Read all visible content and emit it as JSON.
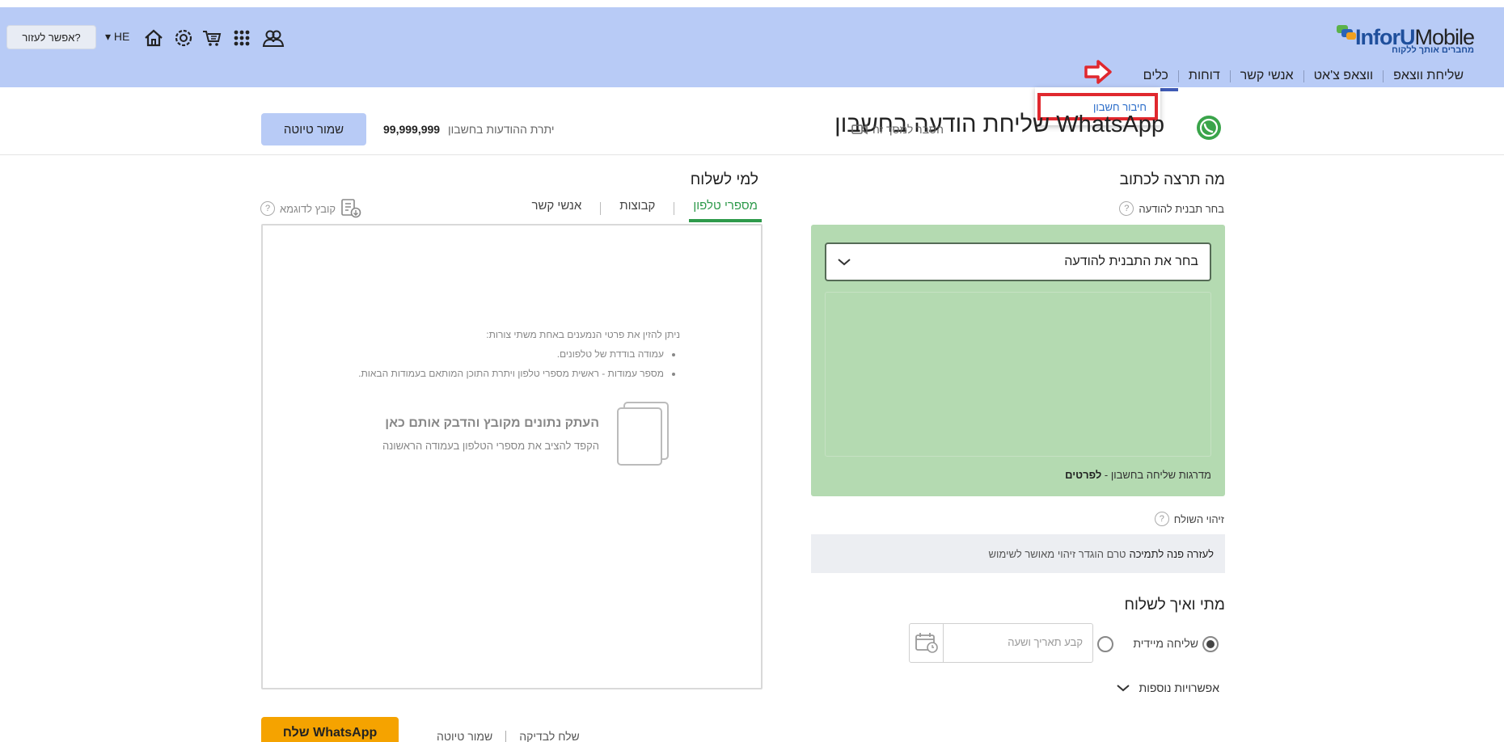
{
  "brand": {
    "logo_main_a": "InforU",
    "logo_main_b": "Mobile",
    "logo_sub": "מחברים אותך ללקוח"
  },
  "nav": {
    "items": [
      "שליחת ווצאפ",
      "ווצאפ צ'אט",
      "אנשי קשר",
      "דוחות",
      "כלים"
    ],
    "active": "כלים"
  },
  "toolbar": {
    "help_label": "אפשר לעזור?",
    "lang_label": "HE",
    "icons": [
      "users-icon",
      "apps-grid-icon",
      "cart-icon",
      "settings-icon",
      "home-icon"
    ]
  },
  "dropdown": {
    "item": "חיבור חשבון"
  },
  "header": {
    "title": "שליחת הודעה בחשבון WhatsApp",
    "help_screen": "הסבר למסך זה",
    "balance_label": "יתרת ההודעות בחשבון",
    "balance_value": "99,999,999",
    "save_draft": "שמור טיוטה"
  },
  "compose": {
    "section_title": "מה תרצה לכתוב",
    "template_label": "בחר תבנית להודעה",
    "template_select": "בחר את התבנית להודעה",
    "tiers_label": "מדרגות שליחה בחשבון -",
    "tiers_link": "לפרטים",
    "sender_label": "זיהוי השולח",
    "sender_text": "טרם הוגדר זיהוי מאושר לשימוש",
    "sender_link": "לעזרה פנה לתמיכה"
  },
  "schedule": {
    "section_title": "מתי ואיך לשלוח",
    "immediate_label": "שליחה מיידית",
    "date_placeholder": "קבע תאריך ושעה",
    "more_options": "אפשרויות נוספות"
  },
  "recipients": {
    "section_title": "למי לשלוח",
    "tabs": [
      "מספרי טלפון",
      "קבוצות",
      "אנשי קשר"
    ],
    "active_tab": "מספרי טלפון",
    "sample_file": "קובץ לדוגמא",
    "intro": "ניתן להזין את פרטי הנמענים באחת משתי צורות:",
    "option1": "עמודה בודדת של טלפונים.",
    "option2": "מספר עמודות - ראשית מספרי טלפון ויתרת התוכן המותאם בעמודות הבאות.",
    "paste_title": "העתק נתונים מקובץ והדבק אותם כאן",
    "paste_sub": "הקפד להציב את מספרי הטלפון בעמודה הראשונה"
  },
  "footer_actions": {
    "send": "שלח WhatsApp",
    "save_draft": "שמור טיוטה",
    "send_test": "שלח לבדיקה"
  },
  "colors": {
    "topbar": "#b8cbf6",
    "accent_green": "#2e9a4b",
    "template_panel": "#b4dab1",
    "send_button": "#f5a300",
    "highlight_red": "#e0282e"
  }
}
